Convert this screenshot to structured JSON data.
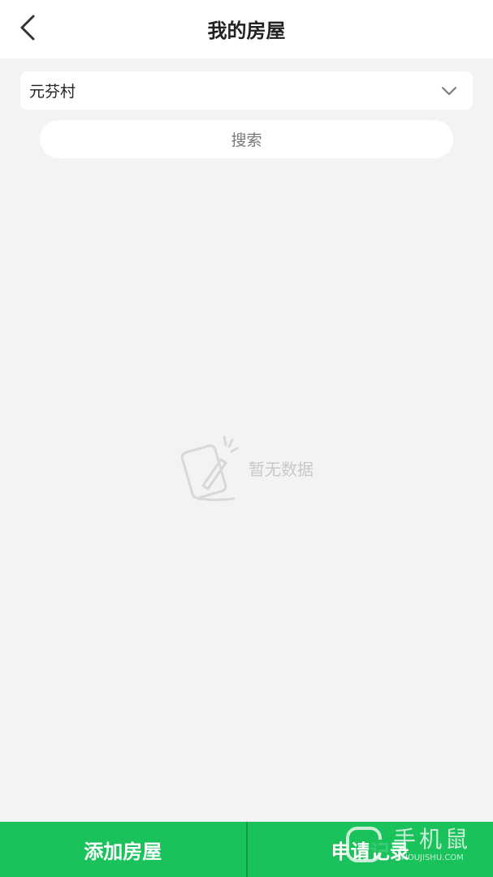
{
  "header": {
    "title": "我的房屋",
    "back_icon": "chevron-left-icon"
  },
  "filter": {
    "selected_village": "元芬村",
    "dropdown_icon": "chevron-down-icon",
    "search_label": "搜索"
  },
  "empty_state": {
    "icon": "empty-note-icon",
    "text": "暂无数据"
  },
  "bottom_bar": {
    "add_label": "添加房屋",
    "records_label": "申请记录"
  },
  "watermark": {
    "title": "手机鼠",
    "sub": "SHOUJISHU.COM"
  },
  "colors": {
    "accent": "#19c25a",
    "background": "#f3f3f3"
  }
}
